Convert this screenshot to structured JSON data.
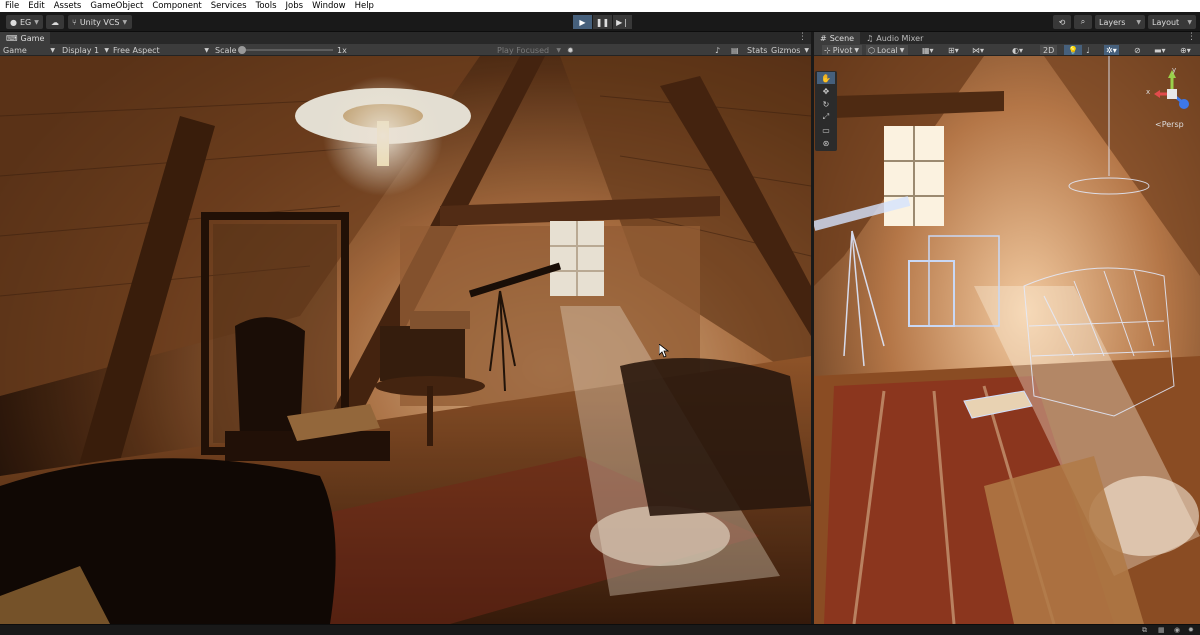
{
  "menu": [
    "File",
    "Edit",
    "Assets",
    "GameObject",
    "Component",
    "Services",
    "Tools",
    "Jobs",
    "Window",
    "Help"
  ],
  "toolbar": {
    "account": "EG",
    "vcs": "Unity VCS",
    "layers": "Layers",
    "layout": "Layout"
  },
  "game_panel": {
    "tab": "Game",
    "mode": "Game",
    "display": "Display 1",
    "aspect": "Free Aspect",
    "scale_label": "Scale",
    "scale_value": "1x",
    "play_mode": "Play Focused",
    "stats": "Stats",
    "gizmos": "Gizmos"
  },
  "scene_panel": {
    "tabs": [
      "Scene",
      "Audio Mixer"
    ],
    "pivot": "Pivot",
    "space": "Local",
    "btn_2d": "2D",
    "persp": "<Persp",
    "axis_x": "x",
    "axis_y": "y"
  },
  "colors": {
    "accent": "#46607c",
    "panel": "#3c3c3c",
    "bar": "#191919"
  }
}
